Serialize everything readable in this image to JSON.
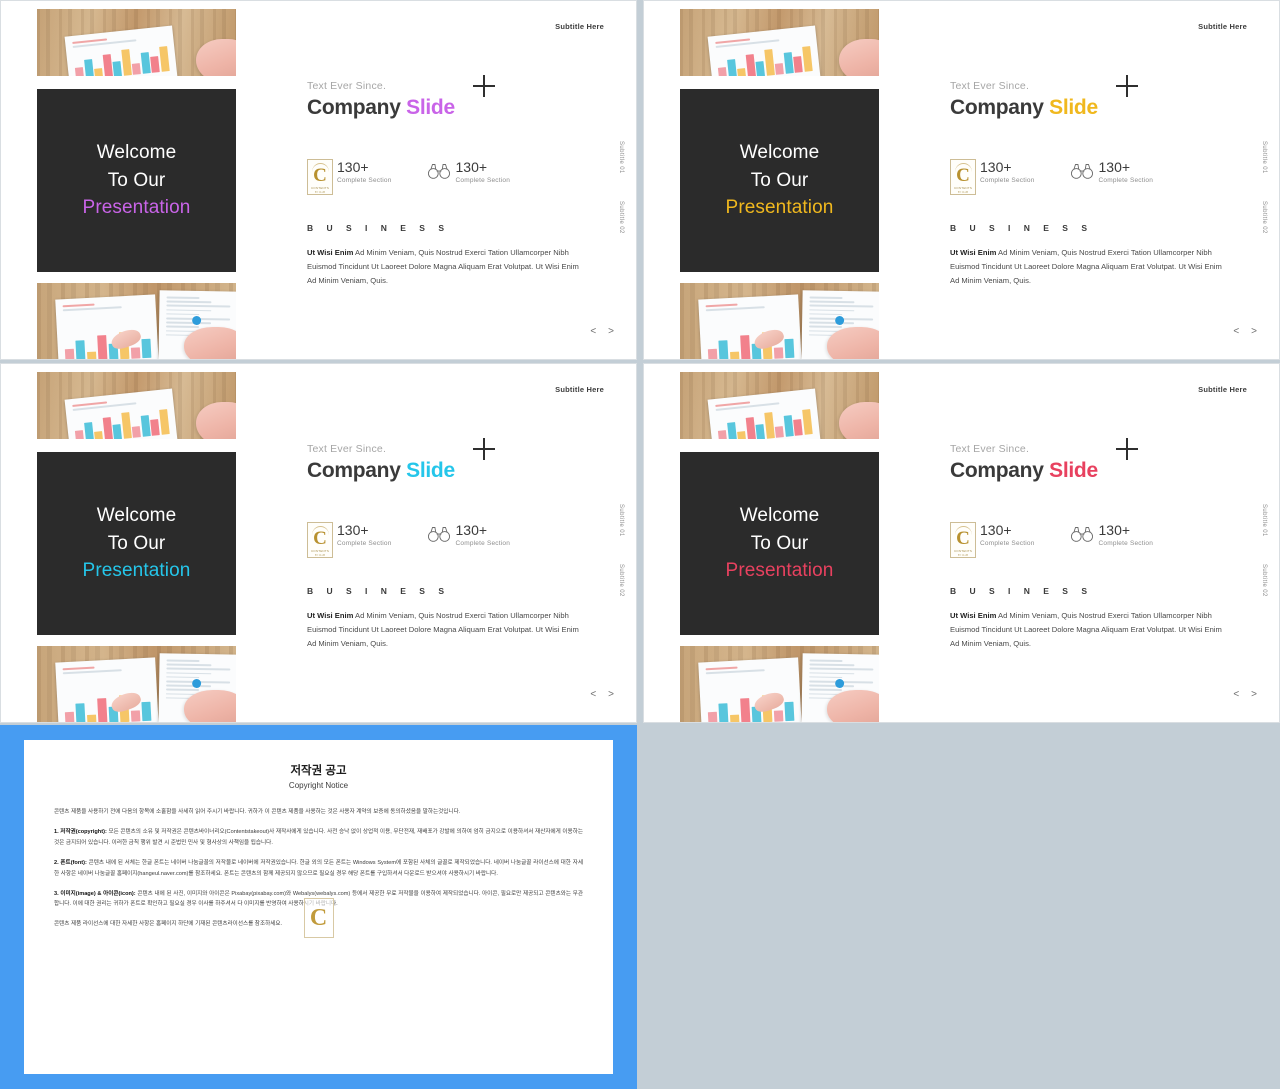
{
  "slides": [
    {
      "accent": "#c964e8",
      "subtitle_here": "Subtitle Here",
      "welcome_line1": "Welcome",
      "welcome_line2": "To Our",
      "welcome_accent": "Presentation",
      "eyebrow": "Text Ever Since.",
      "headline_main": "Company",
      "headline_accent": "Slide",
      "stat1_value": "130+",
      "stat1_label": "Complete Section",
      "stat2_value": "130+",
      "stat2_label": "Complete Section",
      "section_label": "B U S I N E S S",
      "body_bold": "Ut Wisi Enim",
      "body_text": " Ad Minim Veniam, Quis Nostrud Exerci Tation Ullamcorper Nibh Euismod Tincidunt Ut Laoreet Dolore Magna Aliquam Erat Volutpat. Ut Wisi Enim Ad Minim Veniam, Quis.",
      "vlabel1": "Subtitle 01",
      "vlabel2": "Subtitle 02",
      "nav_prev": "<",
      "nav_next": ">",
      "logo_text": "C",
      "logo_label": "CONTENTS",
      "logo_sublabel": "BY  CLUB"
    },
    {
      "accent": "#f0b81e",
      "subtitle_here": "Subtitle Here",
      "welcome_line1": "Welcome",
      "welcome_line2": "To Our",
      "welcome_accent": "Presentation",
      "eyebrow": "Text Ever Since.",
      "headline_main": "Company",
      "headline_accent": "Slide",
      "stat1_value": "130+",
      "stat1_label": "Complete Section",
      "stat2_value": "130+",
      "stat2_label": "Complete Section",
      "section_label": "B U S I N E S S",
      "body_bold": "Ut Wisi Enim",
      "body_text": " Ad Minim Veniam, Quis Nostrud Exerci Tation Ullamcorper Nibh Euismod Tincidunt Ut Laoreet Dolore Magna Aliquam Erat Volutpat. Ut Wisi Enim Ad Minim Veniam, Quis.",
      "vlabel1": "Subtitle 01",
      "vlabel2": "Subtitle 02",
      "nav_prev": "<",
      "nav_next": ">",
      "logo_text": "C",
      "logo_label": "CONTENTS",
      "logo_sublabel": "BY  CLUB"
    },
    {
      "accent": "#25c6ea",
      "subtitle_here": "Subtitle Here",
      "welcome_line1": "Welcome",
      "welcome_line2": "To Our",
      "welcome_accent": "Presentation",
      "eyebrow": "Text Ever Since.",
      "headline_main": "Company",
      "headline_accent": "Slide",
      "stat1_value": "130+",
      "stat1_label": "Complete Section",
      "stat2_value": "130+",
      "stat2_label": "Complete Section",
      "section_label": "B U S I N E S S",
      "body_bold": "Ut Wisi Enim",
      "body_text": " Ad Minim Veniam, Quis Nostrud Exerci Tation Ullamcorper Nibh Euismod Tincidunt Ut Laoreet Dolore Magna Aliquam Erat Volutpat. Ut Wisi Enim Ad Minim Veniam, Quis.",
      "vlabel1": "Subtitle 01",
      "vlabel2": "Subtitle 02",
      "nav_prev": "<",
      "nav_next": ">",
      "logo_text": "C",
      "logo_label": "CONTENTS",
      "logo_sublabel": "BY  CLUB"
    },
    {
      "accent": "#e8415f",
      "subtitle_here": "Subtitle Here",
      "welcome_line1": "Welcome",
      "welcome_line2": "To Our",
      "welcome_accent": "Presentation",
      "eyebrow": "Text Ever Since.",
      "headline_main": "Company",
      "headline_accent": "Slide",
      "stat1_value": "130+",
      "stat1_label": "Complete Section",
      "stat2_value": "130+",
      "stat2_label": "Complete Section",
      "section_label": "B U S I N E S S",
      "body_bold": "Ut Wisi Enim",
      "body_text": " Ad Minim Veniam, Quis Nostrud Exerci Tation Ullamcorper Nibh Euismod Tincidunt Ut Laoreet Dolore Magna Aliquam Erat Volutpat. Ut Wisi Enim Ad Minim Veniam, Quis.",
      "vlabel1": "Subtitle 01",
      "vlabel2": "Subtitle 02",
      "nav_prev": "<",
      "nav_next": ">",
      "logo_text": "C",
      "logo_label": "CONTENTS",
      "logo_sublabel": "BY  CLUB"
    }
  ],
  "copyright": {
    "panel_color": "#479cf2",
    "title": "저작권 공고",
    "subtitle": "Copyright Notice",
    "intro": "콘텐츠 제품을 사용하기 전에 다음의 항목에 소홀함을 사세히 읽어 주시기 바랍니다. 귀하가 이 콘텐츠 제품을 사용하는 것은 사용자 계약의 보증에 동의하셨음을 말하는것입니다.",
    "section1_head": "1. 저작권(copyright):",
    "section1_body": " 모든 콘텐츠의 소유 및 저작권은 콘텐츠바이너리오(Contentstakeout)사 재작사에게 있습니다. 사전 승낙 없이 상업적 이용, 무단전재, 재배포가 강발에 의하여 엄히 금지으로 이용하셔서 재산자에게 이용하는 것은 금지되어 있습니다. 이러한 금칙 행위 발견 시 준법민 민사 및 형사상의 사책임을 됩습니다.",
    "section2_head": "2. 폰트(font):",
    "section2_body": " 콘텐츠 내에 된 서체는 한글 폰트는 네이버 나눔글꼴의 저작물로 네이버에 저작권있습니다. 한글 외의 모든 폰트는 Windows System에 포함된 사체의 글꼴로 제작되었습니다. 네이버 나눔글꼴 라이선스에 대한 자세한 사항은 네이버 나눔글꼴 홈페이지(hangeul.naver.com)를 참조하세요. 폰트는 콘텐츠의 함께 제공되지 않으므로 필요실 경우 해당 폰트를 구입하셔서 다운로드 받으셔야 사용하시기 바랍니다.",
    "section3_head": "3. 이미지(image) & 아이콘(icon):",
    "section3_body": " 콘텐츠 내에 된 사진, 이미지와 아이콘은 Pixabay(pixabay.com)와 Webalys(webalys.com) 등에서 제공한 무료 저작물을 이용하여 제작되었습니다. 아이콘, 필요로만 제공되고 콘텐츠와는 무관합니다. 이에 대한 권리는 귀하가 폰트로 확인하고 필요실 경우 이사를 하주셔서 다 이미지를 반영하여 사용하시기 바랍니다.",
    "outro": "콘텐츠 제품 라이선스에 대한 자세한 사항은 홈페이지 하단에 기재된 콘텐츠라이선스를 참조하세요.",
    "watermark": "C"
  }
}
